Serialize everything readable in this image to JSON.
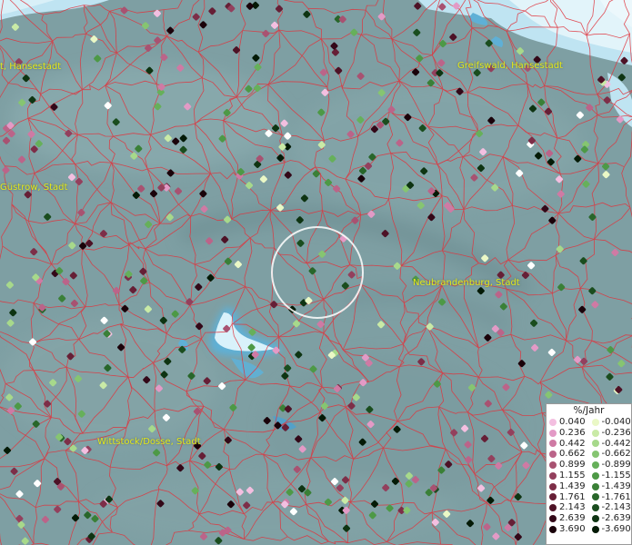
{
  "cities": [
    {
      "id": "hansestadt-west",
      "label": "t, Hansestadt"
    },
    {
      "id": "greifswald",
      "label": "Greifswald, Hansestadt"
    },
    {
      "id": "guestrow",
      "label": "Güstrow, Stadt"
    },
    {
      "id": "neubrandenburg",
      "label": "Neubrandenburg, Stadt"
    },
    {
      "id": "wittstock",
      "label": "Wittstock/Dosse, Stadt"
    }
  ],
  "legend": {
    "title": "%/Jahr",
    "positive": [
      {
        "label": "0.040",
        "color": "#f3bfe0"
      },
      {
        "label": "0.236",
        "color": "#e39ac6"
      },
      {
        "label": "0.442",
        "color": "#cf7aa4"
      },
      {
        "label": "0.662",
        "color": "#bb6489"
      },
      {
        "label": "0.899",
        "color": "#a85271"
      },
      {
        "label": "1.155",
        "color": "#93405d"
      },
      {
        "label": "1.439",
        "color": "#7d2e48"
      },
      {
        "label": "1.761",
        "color": "#661f36"
      },
      {
        "label": "2.143",
        "color": "#4d1226"
      },
      {
        "label": "2.639",
        "color": "#330818"
      },
      {
        "label": "3.690",
        "color": "#1a020a"
      }
    ],
    "negative": [
      {
        "label": "-0.040",
        "color": "#eaf8c6"
      },
      {
        "label": "-0.236",
        "color": "#c9eaa6"
      },
      {
        "label": "-0.442",
        "color": "#a7d98b"
      },
      {
        "label": "-0.662",
        "color": "#86c571"
      },
      {
        "label": "-0.899",
        "color": "#66b05a"
      },
      {
        "label": "-1.155",
        "color": "#4d9946"
      },
      {
        "label": "-1.439",
        "color": "#3a8037"
      },
      {
        "label": "-1.761",
        "color": "#28662a"
      },
      {
        "label": "-2.143",
        "color": "#1a4d1e"
      },
      {
        "label": "-2.639",
        "color": "#0e3412"
      },
      {
        "label": "-3.690",
        "color": "#041a06"
      }
    ]
  },
  "colors": {
    "land": "#7e9fa3",
    "water": "#bfe4f2",
    "water_deep": "#5fb0d6",
    "borders": "#e0333c",
    "city_label": "#e3e81a",
    "selection_ring": "#ffffff",
    "white_station": "#ffffff"
  }
}
